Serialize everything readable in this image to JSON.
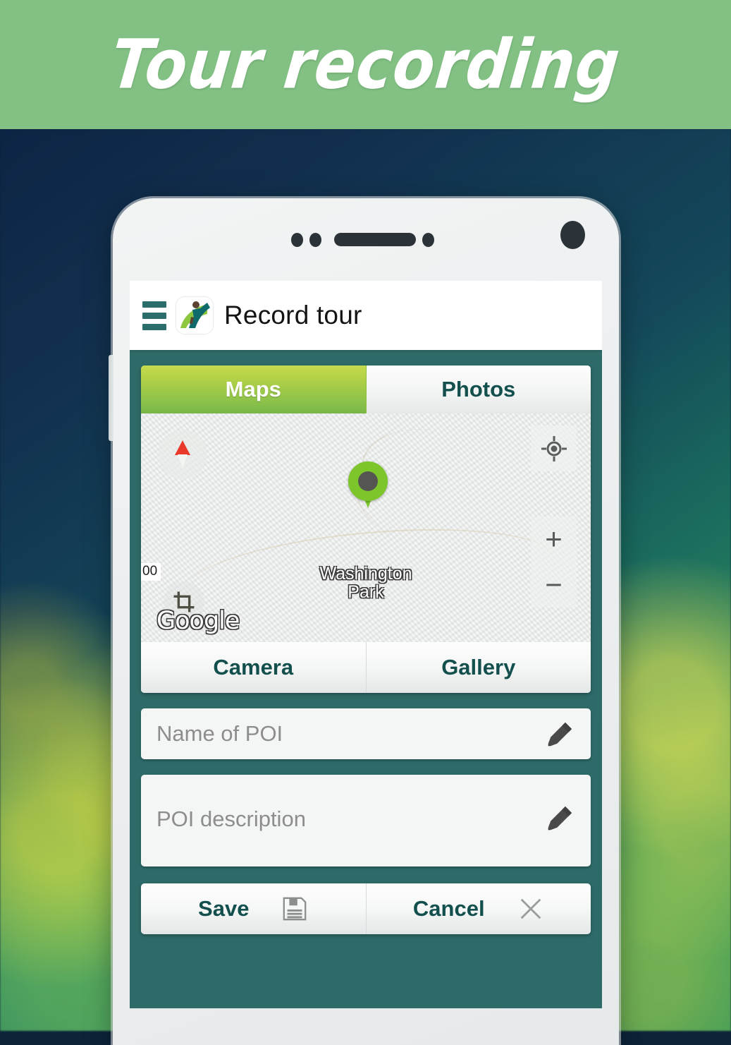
{
  "banner": {
    "title": "Tour recording",
    "background_color": "#82c183",
    "text_color": "#ffffff"
  },
  "device": {
    "frame_color": "#eceff0",
    "sensors": [
      "sensor-dot",
      "sensor-dot",
      "speaker-slot",
      "sensor-dot",
      "front-camera"
    ]
  },
  "app": {
    "background_color": "#2d6a68",
    "accent_green": "#8cc24a",
    "accent_teal": "#13504d",
    "appbar": {
      "menu_icon": "hamburger-icon",
      "logo_icon": "app-logo-hiker-icon",
      "title": "Record tour"
    },
    "tabs": [
      {
        "label": "Maps",
        "active": true
      },
      {
        "label": "Photos",
        "active": false
      }
    ],
    "map": {
      "marker_label": "Washington\nPark",
      "attribution": "Google",
      "scale_text": "00",
      "compass_icon": "compass-icon",
      "my_location_icon": "my-location-icon",
      "zoom_in_label": "+",
      "zoom_out_label": "−",
      "crop_icon": "crop-icon",
      "pin_color": "#7cc62b"
    },
    "media_buttons": [
      {
        "label": "Camera"
      },
      {
        "label": "Gallery"
      }
    ],
    "fields": [
      {
        "name": "poi-name",
        "placeholder": "Name of POI",
        "value": "",
        "icon": "pencil-icon"
      },
      {
        "name": "poi-description",
        "placeholder": "POI description",
        "value": "",
        "icon": "pencil-icon"
      }
    ],
    "actions": [
      {
        "label": "Save",
        "icon": "floppy-disk-icon"
      },
      {
        "label": "Cancel",
        "icon": "close-x-icon"
      }
    ]
  }
}
